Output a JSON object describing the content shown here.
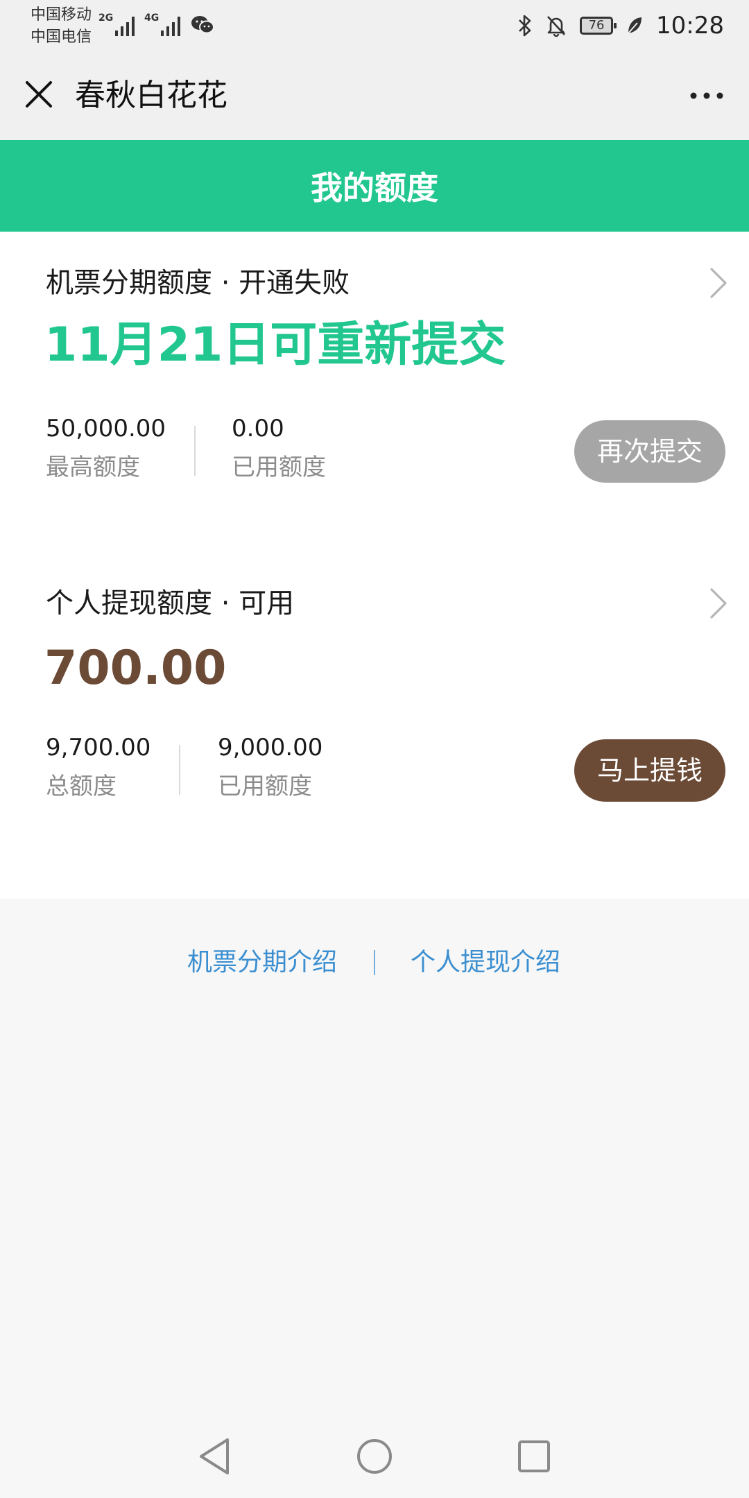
{
  "status_bar": {
    "carrier_1": "中国移动",
    "carrier_2": "中国电信",
    "net_1": "2G",
    "net_2": "4G",
    "battery": "76",
    "time": "10:28"
  },
  "title_bar": {
    "title": "春秋白花花"
  },
  "header": {
    "title": "我的额度"
  },
  "cards": [
    {
      "label": "机票分期额度 · 开通失败",
      "big_value": "11月21日可重新提交",
      "stat_1_value": "50,000.00",
      "stat_1_label": "最高额度",
      "stat_2_value": "0.00",
      "stat_2_label": "已用额度",
      "button": "再次提交"
    },
    {
      "label": "个人提现额度 · 可用",
      "big_value": "700.00",
      "stat_1_value": "9,700.00",
      "stat_1_label": "总额度",
      "stat_2_value": "9,000.00",
      "stat_2_label": "已用额度",
      "button": "马上提钱"
    }
  ],
  "footer": {
    "link_1": "机票分期介绍",
    "link_2": "个人提现介绍"
  },
  "icons": {
    "close": "close-icon",
    "more": "more-icon",
    "chevron": "chevron-right-icon",
    "bluetooth": "bluetooth-icon",
    "mute": "bell-off-icon",
    "wechat": "wechat-icon",
    "leaf": "leaf-icon"
  },
  "colors": {
    "header_green": "#22c78f",
    "accent_green": "#22c78f",
    "accent_brown": "#6b4a36",
    "disabled_gray": "#a6a6a6",
    "link_blue": "#3b8fd1"
  }
}
